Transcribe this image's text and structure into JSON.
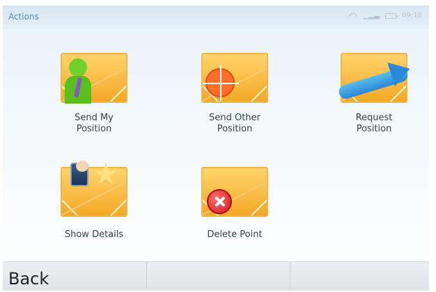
{
  "status": {
    "title": "Actions",
    "icons": [
      "wifi-icon",
      "signal-icon",
      "battery-icon"
    ],
    "time": "09:18"
  },
  "actions": [
    {
      "label": "Send My\nPosition",
      "icon": "person-icon"
    },
    {
      "label": "Send Other\nPosition",
      "icon": "crosshair-icon"
    },
    {
      "label": "Request\nPosition",
      "icon": "arrow-icon"
    },
    {
      "label": "Show Details",
      "icon": "details-icon"
    },
    {
      "label": "Delete Point",
      "icon": "delete-icon"
    }
  ],
  "softkeys": {
    "left": "Back",
    "middle": "",
    "right": ""
  },
  "colors": {
    "accent": "#4f8fb8",
    "envelope": "#f4a827",
    "delete": "#d81717"
  }
}
